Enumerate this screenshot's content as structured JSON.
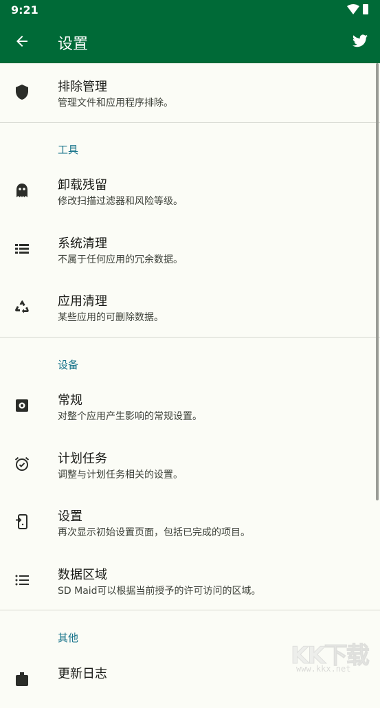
{
  "status": {
    "time": "9:21"
  },
  "appbar": {
    "title": "设置"
  },
  "items": {
    "exclusions": {
      "title": "排除管理",
      "subtitle": "管理文件和应用程序排除。"
    },
    "corpse": {
      "title": "卸载残留",
      "subtitle": "修改扫描过滤器和风险等级。"
    },
    "system": {
      "title": "系统清理",
      "subtitle": "不属于任何应用的冗余数据。"
    },
    "app": {
      "title": "应用清理",
      "subtitle": "某些应用的可删除数据。"
    },
    "general": {
      "title": "常规",
      "subtitle": "对整个应用产生影响的常规设置。"
    },
    "scheduler": {
      "title": "计划任务",
      "subtitle": "调整与计划任务相关的设置。"
    },
    "setup": {
      "title": "设置",
      "subtitle": "再次显示初始设置页面，包括已完成的项目。"
    },
    "dataareas": {
      "title": "数据区域",
      "subtitle": "SD Maid可以根据当前授予的许可访问的区域。"
    },
    "changelog": {
      "title": "更新日志"
    }
  },
  "sections": {
    "tools": "工具",
    "device": "设备",
    "other": "其他"
  },
  "watermark": {
    "logo": "KK下载",
    "url": "www.kkx.net"
  },
  "colors": {
    "primary": "#006a37",
    "section": "#17738a",
    "background": "#fbfcf6"
  }
}
